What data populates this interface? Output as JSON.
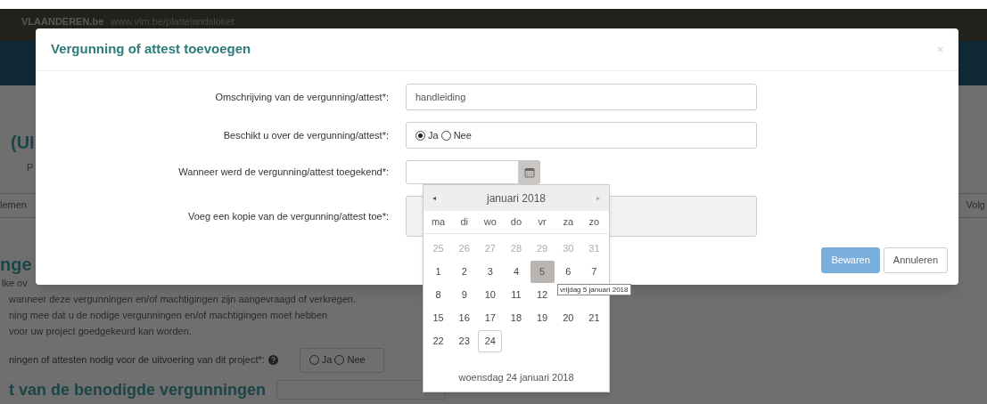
{
  "top_bar": {
    "brand": "VLAANDEREN.be",
    "url": "www.vlm.be/plattelandsloket"
  },
  "background": {
    "heading_1": "(UI",
    "text_1": "P",
    "tab_left": "lemen",
    "tab_right": "Volg",
    "heading_2": "nge",
    "paragraph_lines": [
      "lke ov",
      "wanneer deze vergunningen en/of machtigingen zijn aangevraagd of verkregen.",
      "ning mee dat u de nodige vergunningen en/of machtigingen moet hebben",
      "voor uw project goedgekeurd kan worden."
    ],
    "question": {
      "label": "ningen of attesten nodig voor de uitvoering van dit project*:",
      "options": [
        {
          "label": "Ja",
          "selected": false
        },
        {
          "label": "Nee",
          "selected": false
        }
      ]
    },
    "heading_3": "t van de benodigde vergunningen"
  },
  "modal": {
    "title": "Vergunning of attest toevoegen",
    "close": "×",
    "fields": [
      {
        "kind": "text",
        "label": "Omschrijving van de vergunning/attest*:",
        "value": "handleiding"
      },
      {
        "kind": "radio",
        "label": "Beschikt u over de vergunning/attest*:",
        "options": [
          {
            "label": "Ja",
            "selected": true
          },
          {
            "label": "Nee",
            "selected": false
          }
        ]
      },
      {
        "kind": "date",
        "label": "Wanneer werd de vergunning/attest toegekend*:"
      },
      {
        "kind": "file",
        "label": "Voeg een kopie van de vergunning/attest toe*:"
      }
    ],
    "buttons": [
      {
        "label": "Bewaren",
        "kind": "primary"
      },
      {
        "label": "Annuleren",
        "kind": "default"
      }
    ]
  },
  "datepicker": {
    "prev": "◂",
    "month": "januari 2018",
    "next": "▸",
    "weekdays": [
      "ma",
      "di",
      "wo",
      "do",
      "vr",
      "za",
      "zo"
    ],
    "weeks": [
      [
        {
          "label": "25",
          "kind": "other"
        },
        {
          "label": "26",
          "kind": "other"
        },
        {
          "label": "27",
          "kind": "other"
        },
        {
          "label": "28",
          "kind": "other"
        },
        {
          "label": "29",
          "kind": "other"
        },
        {
          "label": "30",
          "kind": "other"
        },
        {
          "label": "31",
          "kind": "other"
        }
      ],
      [
        {
          "label": "1",
          "kind": "day"
        },
        {
          "label": "2",
          "kind": "day"
        },
        {
          "label": "3",
          "kind": "day"
        },
        {
          "label": "4",
          "kind": "day"
        },
        {
          "label": "5",
          "kind": "hover"
        },
        {
          "label": "6",
          "kind": "day"
        },
        {
          "label": "7",
          "kind": "day"
        }
      ],
      [
        {
          "label": "8",
          "kind": "day"
        },
        {
          "label": "9",
          "kind": "day"
        },
        {
          "label": "10",
          "kind": "day"
        },
        {
          "label": "11",
          "kind": "day"
        },
        {
          "label": "12",
          "kind": "day"
        }
      ],
      [
        {
          "label": "15",
          "kind": "day"
        },
        {
          "label": "16",
          "kind": "day"
        },
        {
          "label": "17",
          "kind": "day"
        },
        {
          "label": "18",
          "kind": "day"
        },
        {
          "label": "19",
          "kind": "day"
        },
        {
          "label": "20",
          "kind": "day"
        },
        {
          "label": "21",
          "kind": "day"
        }
      ],
      [
        {
          "label": "22",
          "kind": "day"
        },
        {
          "label": "23",
          "kind": "day"
        },
        {
          "label": "24",
          "kind": "today"
        }
      ]
    ],
    "tooltip": "vrijdag 5 januari 2018",
    "footer": "woensdag 24 januari 2018"
  }
}
